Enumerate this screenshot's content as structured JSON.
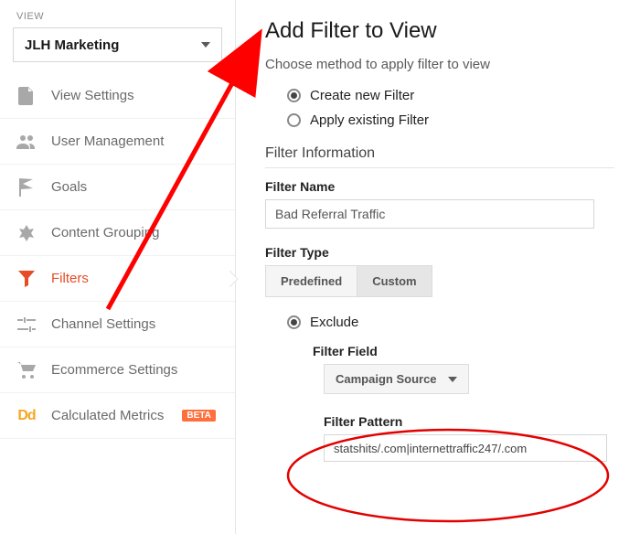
{
  "sidebar": {
    "view_label": "VIEW",
    "dropdown_value": "JLH Marketing",
    "items": [
      {
        "label": "View Settings"
      },
      {
        "label": "User Management"
      },
      {
        "label": "Goals"
      },
      {
        "label": "Content Grouping"
      },
      {
        "label": "Filters"
      },
      {
        "label": "Channel Settings"
      },
      {
        "label": "Ecommerce Settings"
      },
      {
        "label": "Calculated Metrics",
        "badge": "BETA"
      }
    ],
    "active_index": 4
  },
  "main": {
    "title": "Add Filter to View",
    "method_label": "Choose method to apply filter to view",
    "method_options": [
      {
        "label": "Create new Filter",
        "checked": true
      },
      {
        "label": "Apply existing Filter",
        "checked": false
      }
    ],
    "info_heading": "Filter Information",
    "filter_name_label": "Filter Name",
    "filter_name_value": "Bad Referral Traffic",
    "filter_type_label": "Filter Type",
    "type_tabs": [
      {
        "label": "Predefined",
        "active": false
      },
      {
        "label": "Custom",
        "active": true
      }
    ],
    "exclude_label": "Exclude",
    "exclude_checked": true,
    "filter_field_label": "Filter Field",
    "filter_field_value": "Campaign Source",
    "filter_pattern_label": "Filter Pattern",
    "filter_pattern_value": "statshits/.com|internettraffic247/.com"
  },
  "annotation": {
    "arrow_color": "#ff0000",
    "ellipse_color": "#e30000"
  }
}
